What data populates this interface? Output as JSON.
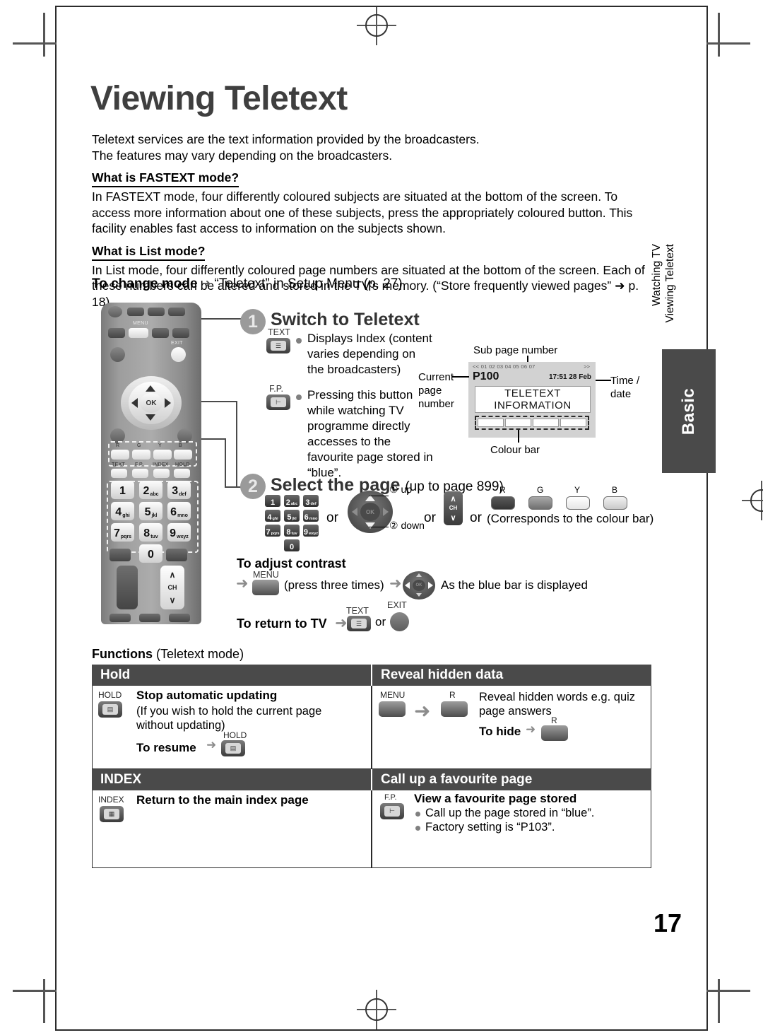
{
  "page": {
    "title": "Viewing Teletext",
    "number": "17"
  },
  "intro": {
    "line1": "Teletext services are the text information provided by the broadcasters.",
    "line2": "The features may vary depending on the broadcasters.",
    "fastext_heading": "What is FASTEXT mode?",
    "fastext_body": "In FASTEXT mode, four differently coloured subjects are situated at the bottom of the screen. To access more information about one of these subjects, press the appropriately coloured button. This facility enables fast access to information on the subjects shown.",
    "list_heading": "What is List mode?",
    "list_body": "In List mode, four differently coloured page numbers are situated at the bottom of the screen. Each of these numbers can be altered and stored in the TV's memory. (“Store frequently viewed pages” ➜ p. 18)"
  },
  "to_change_mode": {
    "label": "To change mode",
    "arrow": "➜",
    "value": "“Teletext” in Setup Menu (p. 27)"
  },
  "side_tab": {
    "line1": "Watching TV",
    "line2": "Viewing Teletext",
    "tab_label": "Basic"
  },
  "steps": [
    {
      "num": "1",
      "title": "Switch to Teletext",
      "items": [
        {
          "key_label": "TEXT",
          "key_icon": "teletext-icon",
          "text": "Displays Index (content varies depending on the broadcasters)"
        },
        {
          "key_label": "F.P.",
          "key_icon": "favourite-page-icon",
          "text": "Pressing this button while watching TV programme directly accesses to the favourite page stored in “blue”."
        }
      ]
    },
    {
      "num": "2",
      "title": "Select the page",
      "title_suffix": "(up to page 899)",
      "or1": "or",
      "or2": "or",
      "or3": "or",
      "up_label": "① up",
      "down_label": "② down",
      "ch_label": "CH",
      "corresponds": "(Corresponds to the colour bar)",
      "numpad": [
        {
          "d": "1",
          "s": ""
        },
        {
          "d": "2",
          "s": "abc"
        },
        {
          "d": "3",
          "s": "def"
        },
        {
          "d": "4",
          "s": "ghi"
        },
        {
          "d": "5",
          "s": "jkl"
        },
        {
          "d": "6",
          "s": "mno"
        },
        {
          "d": "7",
          "s": "pqrs"
        },
        {
          "d": "8",
          "s": "tuv"
        },
        {
          "d": "9",
          "s": "wxyz"
        },
        {
          "d": "0",
          "s": ""
        }
      ],
      "colour_buttons": [
        {
          "label": "R",
          "color": "#4a4a4a"
        },
        {
          "label": "G",
          "color": "#8b8b8b"
        },
        {
          "label": "Y",
          "color": "#eeeeee"
        },
        {
          "label": "B",
          "color": "#d0d0d0"
        }
      ]
    }
  ],
  "tv_screen": {
    "sub_page_label": "Sub page number",
    "sub_page_values": "<< 01 02 03 04 05 06 07",
    "sub_page_next": ">>",
    "current_page_label": "Current\npage\nnumber",
    "current_page_l1": "Current",
    "current_page_l2": "page",
    "current_page_l3": "number",
    "page_value": "P100",
    "time_value": "17:51 28 Feb",
    "time_label_l1": "Time /",
    "time_label_l2": "date",
    "body_line1": "TELETEXT",
    "body_line2": "INFORMATION",
    "colour_bar_label": "Colour bar"
  },
  "adjust_contrast": {
    "heading": "To adjust contrast",
    "arrow": "➜",
    "menu_label": "MENU",
    "press_text": "(press three times)",
    "arrow2": "➜",
    "result_text": "As the blue bar is displayed"
  },
  "return_to_tv": {
    "heading": "To return to TV",
    "arrow": "➜",
    "text_key": "TEXT",
    "or": "or",
    "exit_key": "EXIT"
  },
  "functions": {
    "heading_bold": "Functions",
    "heading_rest": "(Teletext mode)",
    "cells": [
      {
        "header": "Hold",
        "key_cap": "HOLD",
        "key_icon": "hold-icon",
        "title": "Stop automatic updating",
        "body_l1": "(If you wish to hold the current page",
        "body_l2": "without updating)",
        "resume_label": "To resume",
        "resume_arrow": "➜",
        "resume_key_cap": "HOLD"
      },
      {
        "header": "Reveal hidden data",
        "key_cap": "MENU",
        "arrow": "➜",
        "second_key_cap": "R",
        "body_l1": "Reveal hidden words e.g. quiz",
        "body_l2": "page answers",
        "hide_label": "To hide",
        "hide_arrow": "➜",
        "hide_key_cap": "R"
      },
      {
        "header": "INDEX",
        "key_cap": "INDEX",
        "key_icon": "index-icon",
        "title": "Return to the main index page"
      },
      {
        "header": "Call up a favourite page",
        "key_cap": "F.P.",
        "key_icon": "favourite-page-icon",
        "title": "View a favourite page stored",
        "bullet1": "Call up the page stored in “blue”.",
        "bullet2": "Factory setting is “P103”."
      }
    ]
  },
  "remote": {
    "menu_label": "MENU",
    "exit_label": "EXIT",
    "ok_label": "OK",
    "colour_caps": [
      "R",
      "G",
      "Y",
      "B"
    ],
    "fn_caps": [
      "TEXT",
      "F.P.",
      "INDEX",
      "HOLD"
    ],
    "ch_label": "CH"
  },
  "colors": {
    "header_bar": "#4a4a4a",
    "title": "#3f3f3f",
    "step_circle": "#9a9a9a"
  }
}
